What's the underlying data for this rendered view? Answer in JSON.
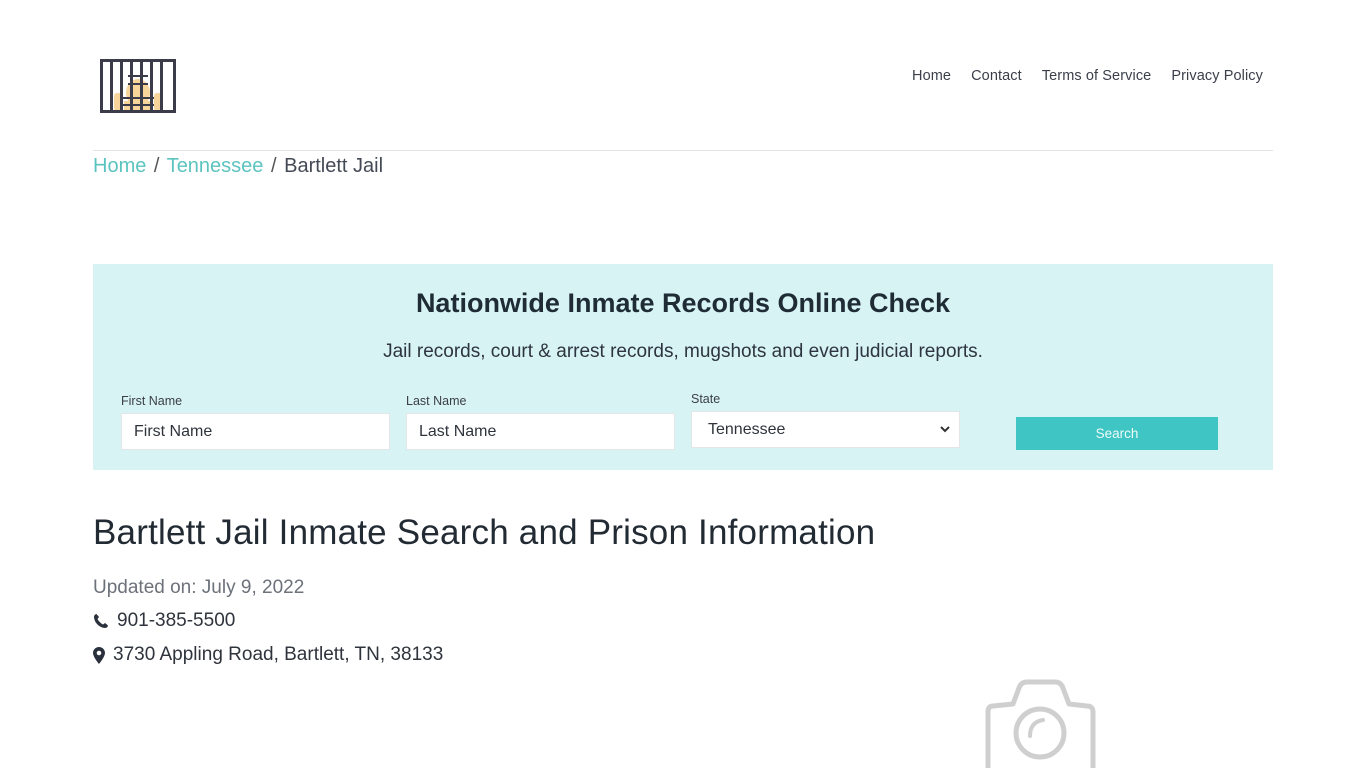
{
  "header": {
    "logo_icon": "jail-cell-icon",
    "nav": [
      {
        "label": "Home"
      },
      {
        "label": "Contact"
      },
      {
        "label": "Terms of Service"
      },
      {
        "label": "Privacy Policy"
      }
    ]
  },
  "breadcrumb": {
    "items": [
      {
        "label": "Home",
        "link": true
      },
      {
        "label": "Tennessee",
        "link": true
      },
      {
        "label": "Bartlett Jail",
        "link": false
      }
    ],
    "separator": "/"
  },
  "search": {
    "title": "Nationwide Inmate Records Online Check",
    "subtitle": "Jail records, court & arrest records, mugshots and even judicial reports.",
    "first_name": {
      "label": "First Name",
      "placeholder": "First Name",
      "value": ""
    },
    "last_name": {
      "label": "Last Name",
      "placeholder": "Last Name",
      "value": ""
    },
    "state": {
      "label": "State",
      "selected": "Tennessee"
    },
    "button_label": "Search"
  },
  "main": {
    "title": "Bartlett Jail Inmate Search and Prison Information",
    "updated": "Updated on: July 9, 2022",
    "phone": "901-385-5500",
    "address": "3730 Appling Road, Bartlett, TN, 38133",
    "image_placeholder_icon": "camera-icon"
  },
  "colors": {
    "accent": "#3fc6c4",
    "link": "#5cc4bf",
    "search_bg": "#d7f3f4",
    "text_dark": "#222a33"
  }
}
